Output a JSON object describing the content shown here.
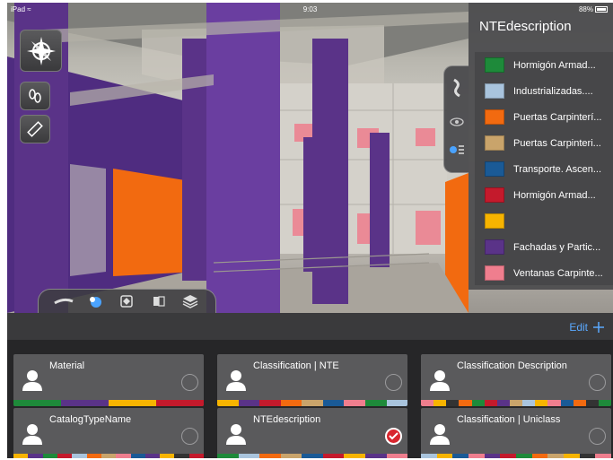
{
  "status_bar": {
    "device": "iPad",
    "time": "9:03",
    "battery": "88%"
  },
  "tools": {
    "compass": "compass-icon",
    "walk": "footprints-icon",
    "measure": "ruler-icon"
  },
  "scene_dock": [
    "section-icon",
    "visibility-icon",
    "zoom-extents-icon",
    "xray-icon",
    "layers-icon"
  ],
  "sidetab": [
    "tag-icon",
    "eye-icon",
    "legend-icon"
  ],
  "legend": {
    "title": "NTEdescription",
    "items": [
      {
        "label": "Hormigón Armad...",
        "color": "#1e8a3a"
      },
      {
        "label": "Industrializadas....",
        "color": "#a9c4dd"
      },
      {
        "label": "Puertas Carpinterí...",
        "color": "#f26a10"
      },
      {
        "label": "Puertas Carpinteri...",
        "color": "#c9a46b"
      },
      {
        "label": "Transporte. Ascen...",
        "color": "#1a5a96"
      },
      {
        "label": "Hormigón Armad...",
        "color": "#c41a2c"
      },
      {
        "label": "",
        "color": "#f7b400"
      },
      {
        "label": "Fachadas y Partic...",
        "color": "#5a3388"
      },
      {
        "label": "Ventanas Carpinte...",
        "color": "#ef7e8e"
      }
    ]
  },
  "panel": {
    "edit_label": "Edit"
  },
  "cards": [
    {
      "title": "Material",
      "selected": false,
      "stripe": [
        "#1e8a3a",
        "#1e8a3a",
        "#5a3388",
        "#5a3388",
        "#f7b400",
        "#f7b400",
        "#c41a2c",
        "#c41a2c"
      ]
    },
    {
      "title": "Classification | NTE",
      "selected": false,
      "stripe": [
        "#f7b400",
        "#5a3388",
        "#c41a2c",
        "#f26a10",
        "#c9a46b",
        "#1a5a96",
        "#ef7e8e",
        "#1e8a3a",
        "#a9c4dd"
      ]
    },
    {
      "title": "Classification Description",
      "selected": false,
      "stripe": [
        "#ef7e8e",
        "#f7b400",
        "#333333",
        "#f26a10",
        "#1e8a3a",
        "#c41a2c",
        "#5a3388",
        "#c9a46b",
        "#a9c4dd",
        "#f7b400",
        "#ef7e8e",
        "#1a5a96",
        "#f26a10",
        "#333333",
        "#1e8a3a"
      ]
    },
    {
      "title": "CatalogTypeName",
      "selected": false,
      "stripe": [
        "#f7b400",
        "#5a3388",
        "#1e8a3a",
        "#c41a2c",
        "#a9c4dd",
        "#f26a10",
        "#c9a46b",
        "#ef7e8e",
        "#1a5a96",
        "#5a3388",
        "#f7b400",
        "#333333",
        "#c41a2c"
      ]
    },
    {
      "title": "NTEdescription",
      "selected": true,
      "stripe": [
        "#1e8a3a",
        "#a9c4dd",
        "#f26a10",
        "#c9a46b",
        "#1a5a96",
        "#c41a2c",
        "#f7b400",
        "#5a3388",
        "#ef7e8e"
      ]
    },
    {
      "title": "Classification | Uniclass",
      "selected": false,
      "stripe": [
        "#a9c4dd",
        "#f7b400",
        "#1a5a96",
        "#ef7e8e",
        "#5a3388",
        "#c41a2c",
        "#1e8a3a",
        "#f26a10",
        "#c9a46b",
        "#f7b400",
        "#333333",
        "#ef7e8e"
      ]
    }
  ]
}
